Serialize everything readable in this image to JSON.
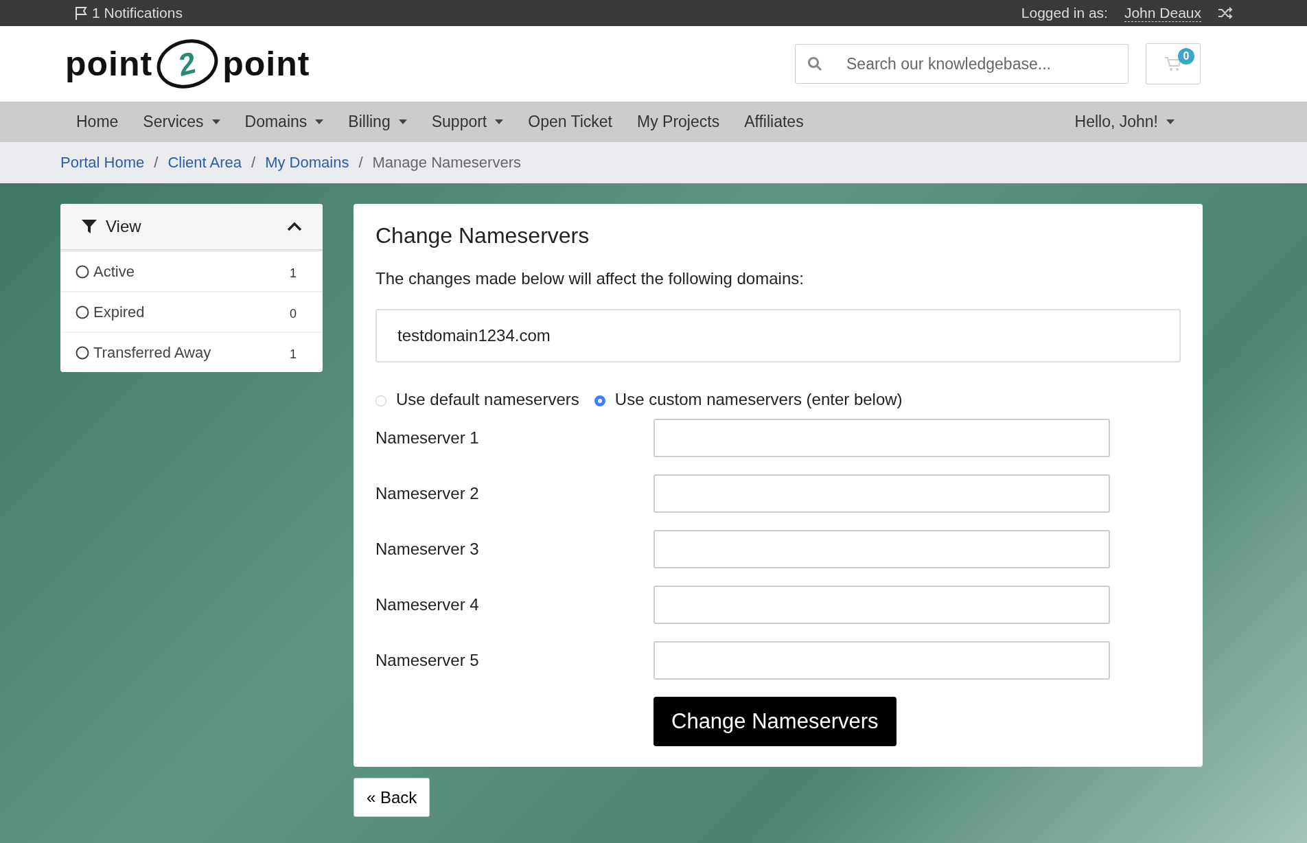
{
  "top_bar": {
    "notifications": "1 Notifications",
    "logged_in_label": "Logged in as:",
    "user_name": "John Deaux"
  },
  "header": {
    "logo": {
      "left": "point",
      "middle": "2",
      "right": "point"
    },
    "search": {
      "placeholder": "Search our knowledgebase..."
    },
    "cart_count": "0"
  },
  "nav": {
    "items": [
      {
        "label": "Home",
        "dropdown": false
      },
      {
        "label": "Services",
        "dropdown": true
      },
      {
        "label": "Domains",
        "dropdown": true
      },
      {
        "label": "Billing",
        "dropdown": true
      },
      {
        "label": "Support",
        "dropdown": true
      },
      {
        "label": "Open Ticket",
        "dropdown": false
      },
      {
        "label": "My Projects",
        "dropdown": false
      },
      {
        "label": "Affiliates",
        "dropdown": false
      }
    ],
    "user_menu": "Hello, John!"
  },
  "breadcrumb": [
    {
      "label": "Portal Home",
      "link": true
    },
    {
      "separator": "/",
      "label": "Client Area",
      "link": true
    },
    {
      "separator": "/",
      "label": "My Domains",
      "link": true
    },
    {
      "separator": "/",
      "label": "Manage Nameservers",
      "link": false
    }
  ],
  "sidebar": {
    "title": "View",
    "expanded": true,
    "items": [
      {
        "label": "Active",
        "count": "1",
        "selected": false
      },
      {
        "label": "Expired",
        "count": "0",
        "selected": false
      },
      {
        "label": "Transferred Away",
        "count": "1",
        "selected": false
      }
    ]
  },
  "card": {
    "title": "Change Nameservers",
    "intro": "The changes made below will affect the following domains:",
    "domains": "testdomain1234.com",
    "options": [
      {
        "label": "Use default nameservers",
        "selected": false
      },
      {
        "label": "Use custom nameservers (enter below)",
        "selected": true
      }
    ],
    "nameservers": [
      {
        "label": "Nameserver 1"
      },
      {
        "label": "Nameserver 2"
      },
      {
        "label": "Nameserver 3"
      },
      {
        "label": "Nameserver 4"
      },
      {
        "label": "Nameserver 5"
      }
    ],
    "submit": "Change Nameservers"
  },
  "back": "« Back"
}
